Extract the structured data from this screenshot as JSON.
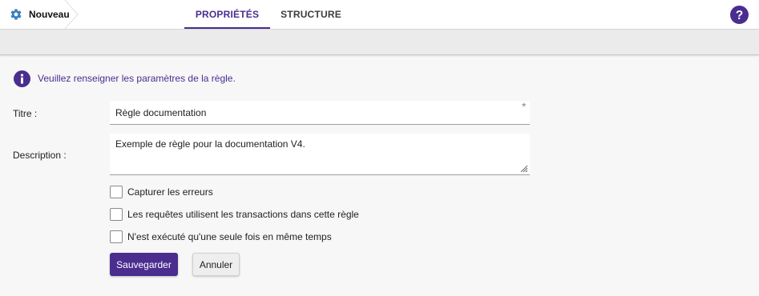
{
  "breadcrumb": {
    "label": "Nouveau",
    "icon": "gear-icon"
  },
  "tabs": [
    {
      "label": "PROPRIÉTÉS",
      "active": true
    },
    {
      "label": "STRUCTURE",
      "active": false
    }
  ],
  "help": {
    "icon": "help-icon"
  },
  "info": {
    "icon": "info-icon",
    "text": "Veuillez renseigner les paramètres de la règle."
  },
  "form": {
    "title_label": "Titre :",
    "title_value": "Règle documentation",
    "title_required_mark": "*",
    "description_label": "Description :",
    "description_value": "Exemple de règle pour la documentation V4.",
    "checkboxes": [
      {
        "label": "Capturer les erreurs",
        "checked": false
      },
      {
        "label": "Les requêtes utilisent les transactions dans cette règle",
        "checked": false
      },
      {
        "label": "N'est exécuté qu'une seule fois en même temps",
        "checked": false
      }
    ],
    "save_label": "Sauvegarder",
    "cancel_label": "Annuler"
  },
  "colors": {
    "accent": "#4a2d8f",
    "gear": "#3f7fc1",
    "background": "#f7f7f7"
  }
}
